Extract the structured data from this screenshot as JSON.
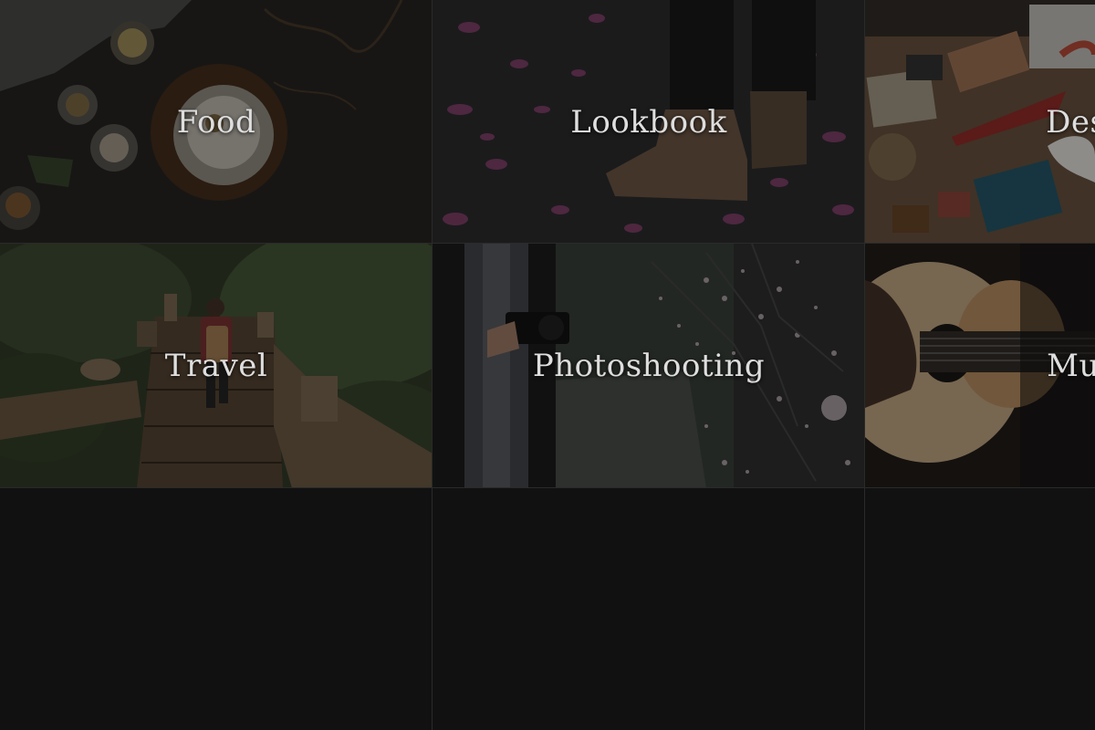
{
  "categories": [
    {
      "label": "Food",
      "icon": "food-photo"
    },
    {
      "label": "Lookbook",
      "icon": "boots-photo"
    },
    {
      "label": "Desi",
      "icon": "design-flatlay-photo"
    },
    {
      "label": "Travel",
      "icon": "hiker-photo"
    },
    {
      "label": "Photoshooting",
      "icon": "camera-blossoms-photo"
    },
    {
      "label": "Mus",
      "icon": "guitar-photo"
    }
  ],
  "colors": {
    "background": "#111111",
    "label": "#dedede",
    "divider": "#2a2a2a"
  }
}
